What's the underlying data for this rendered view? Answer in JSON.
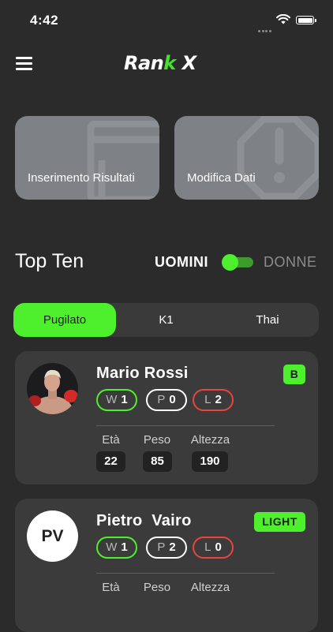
{
  "status_bar": {
    "time": "4:42"
  },
  "app": {
    "logo_part1": "Ran",
    "logo_part2": "k",
    "logo_part3": " X"
  },
  "action_cards": [
    {
      "label": "Inserimento Risultati",
      "icon": "document-icon"
    },
    {
      "label": "Modifica Dati",
      "icon": "warning-octagon-icon"
    }
  ],
  "ranking": {
    "title": "Top Ten",
    "gender_men": "UOMINI",
    "gender_women": "DONNE",
    "gender_selected": "UOMINI"
  },
  "tabs": [
    {
      "label": "Pugilato",
      "active": true
    },
    {
      "label": "K1",
      "active": false
    },
    {
      "label": "Thai",
      "active": false
    }
  ],
  "athletes": [
    {
      "name": "Mario Rossi",
      "category": "B",
      "avatar": "photo",
      "record": {
        "w_label": "W",
        "w": "1",
        "p_label": "P",
        "p": "0",
        "l_label": "L",
        "l": "2"
      },
      "stats": {
        "age_label": "Età",
        "age": "22",
        "weight_label": "Peso",
        "weight": "85",
        "height_label": "Altezza",
        "height": "190"
      }
    },
    {
      "name": "Pietro  Vairo",
      "category": "LIGHT",
      "avatar": "PV",
      "record": {
        "w_label": "W",
        "w": "1",
        "p_label": "P",
        "p": "2",
        "l_label": "L",
        "l": "0"
      },
      "stats": {
        "age_label": "Età",
        "age_value": "",
        "weight_label": "Peso",
        "height_label": "Altezza"
      }
    }
  ],
  "colors": {
    "accent": "#4ef02d",
    "loss": "#e8453c",
    "background": "#2b2b2b",
    "card": "#3b3b3b"
  }
}
